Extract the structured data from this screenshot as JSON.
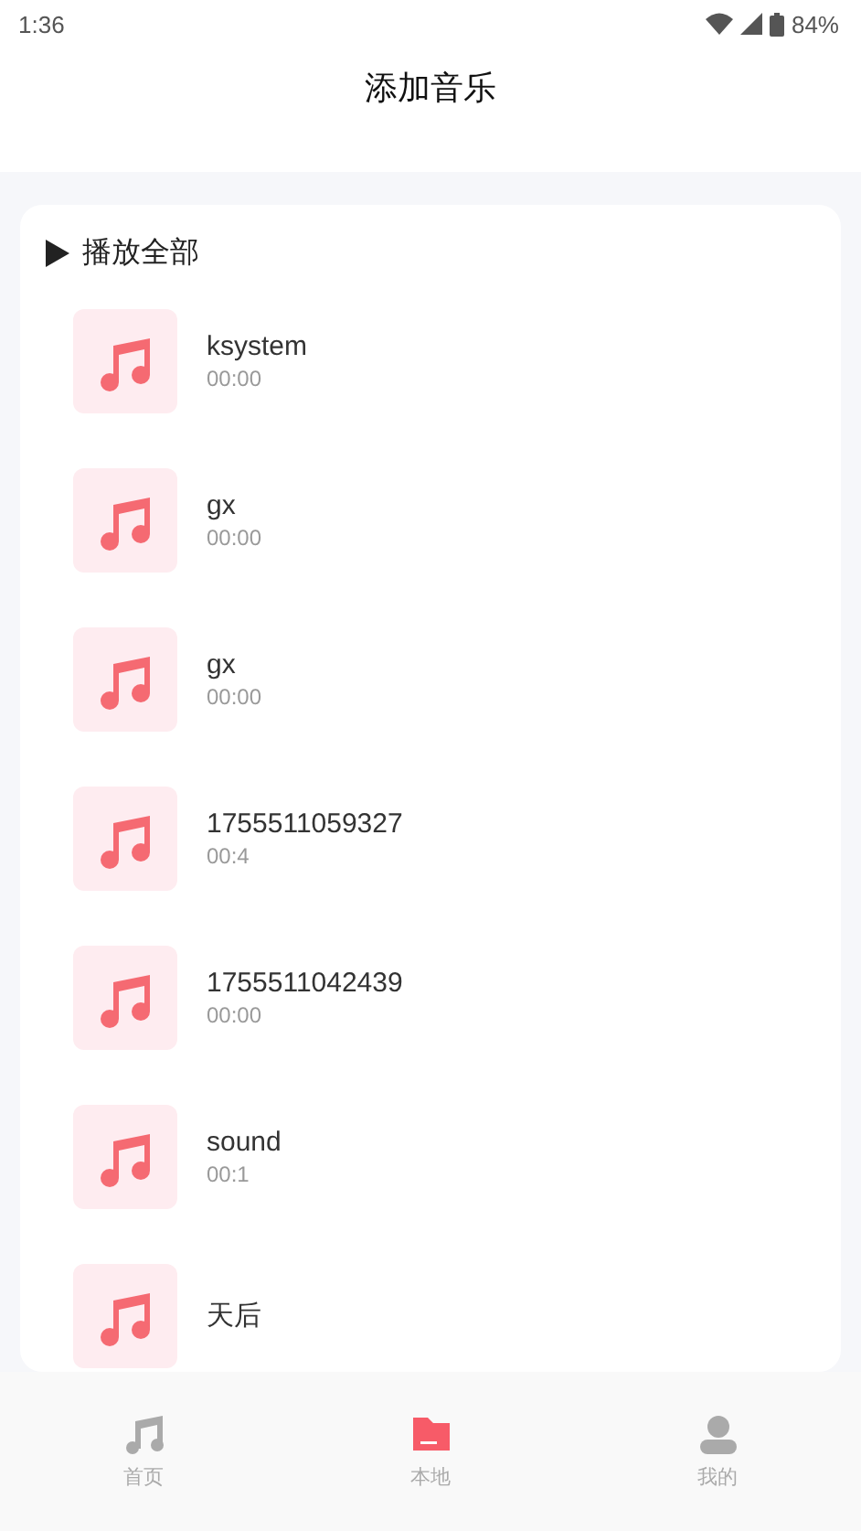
{
  "status_bar": {
    "time": "1:36",
    "battery": "84%"
  },
  "header": {
    "title": "添加音乐"
  },
  "play_all": {
    "label": "播放全部"
  },
  "songs": [
    {
      "title": "ksystem",
      "duration": "00:00"
    },
    {
      "title": "gx",
      "duration": "00:00"
    },
    {
      "title": "gx",
      "duration": "00:00"
    },
    {
      "title": "1755511059327",
      "duration": "00:4"
    },
    {
      "title": "1755511042439",
      "duration": "00:00"
    },
    {
      "title": "sound",
      "duration": "00:1"
    },
    {
      "title": "天后"
    }
  ],
  "tabs": [
    {
      "label": "首页",
      "kind": "home",
      "selected": false
    },
    {
      "label": "本地",
      "kind": "local",
      "selected": true
    },
    {
      "label": "我的",
      "kind": "mine",
      "selected": false
    }
  ]
}
